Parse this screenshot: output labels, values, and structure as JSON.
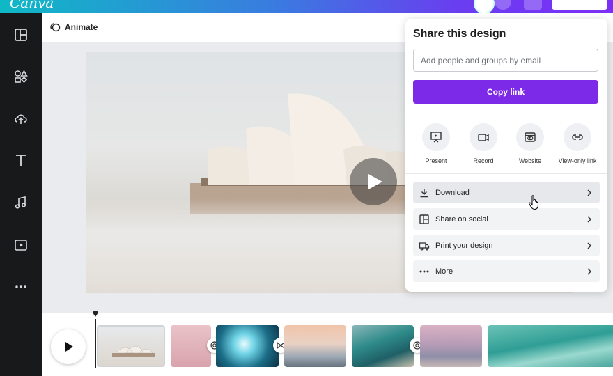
{
  "app": {
    "logo": "Canva"
  },
  "toolbar": {
    "animate_label": "Animate"
  },
  "share": {
    "title": "Share this design",
    "input_placeholder": "Add people and groups by email",
    "copy_link_label": "Copy link",
    "options": [
      {
        "label": "Present",
        "icon": "present-icon"
      },
      {
        "label": "Record",
        "icon": "record-icon"
      },
      {
        "label": "Website",
        "icon": "website-icon"
      },
      {
        "label": "View-only link",
        "icon": "link-icon"
      }
    ],
    "rows": [
      {
        "label": "Download",
        "icon": "download-icon"
      },
      {
        "label": "Share on social",
        "icon": "social-icon"
      },
      {
        "label": "Print your design",
        "icon": "truck-icon"
      },
      {
        "label": "More",
        "icon": "more-dots-icon"
      }
    ]
  },
  "colors": {
    "accent": "#7d2ae8",
    "sidebar": "#18191b"
  }
}
